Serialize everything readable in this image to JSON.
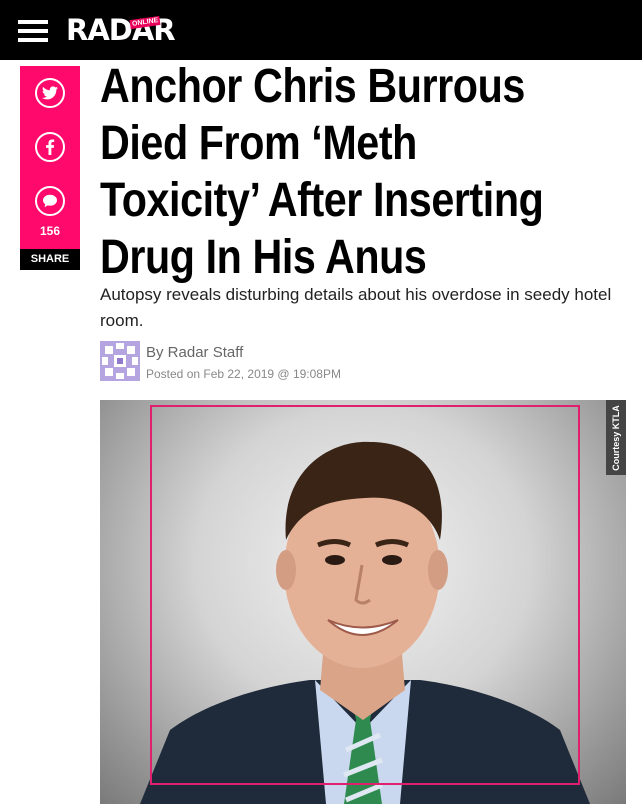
{
  "header": {
    "logo_text": "RADAR",
    "logo_badge": "ONLINE",
    "menu_icon": "hamburger-icon",
    "background": "#000000"
  },
  "share": {
    "accent": "#ff0a6c",
    "buttons": [
      {
        "icon": "twitter-icon"
      },
      {
        "icon": "facebook-icon"
      },
      {
        "icon": "comment-icon"
      }
    ],
    "comment_count": "156",
    "label": "SHARE"
  },
  "article": {
    "headline_lines": [
      "Anchor Chris Burrous",
      "Died From ‘Meth",
      "Toxicity’ After Inserting",
      "Drug In His Anus"
    ],
    "subheadline": "Autopsy reveals disturbing details about his overdose in seedy hotel room.",
    "author": "By Radar Staff",
    "posted": "Posted on Feb 22, 2019 @ 19:08PM",
    "image_credit": "Courtesy KTLA"
  }
}
